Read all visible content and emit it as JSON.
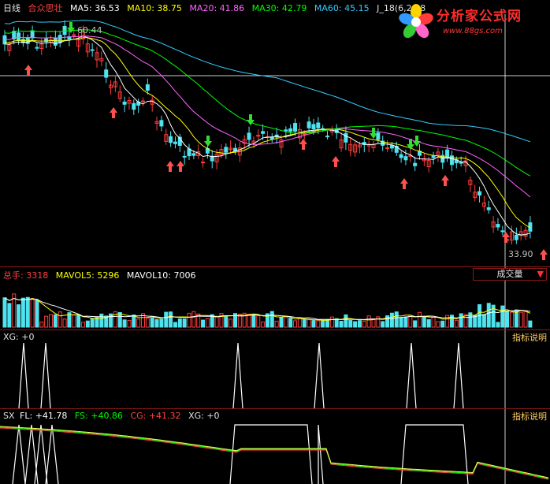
{
  "main": {
    "period": "日线",
    "stock": "合众思壮",
    "ma": [
      {
        "label": "MA5: 36.53",
        "color": "#ffffff"
      },
      {
        "label": "MA10: 38.75",
        "color": "#ffff00"
      },
      {
        "label": "MA20: 41.86",
        "color": "#ff66ff"
      },
      {
        "label": "MA30: 42.79",
        "color": "#00ff00"
      },
      {
        "label": "MA60: 45.15",
        "color": "#33ccff"
      }
    ],
    "extra": "J_18(6,20,8",
    "high_label": "60.44",
    "low_label": "33.90"
  },
  "logo": {
    "title": "分析家公式网",
    "url": "www.88gs.com"
  },
  "volume": {
    "name": "总手:",
    "value": "3318",
    "mavol5": "MAVOL5: 5296",
    "mavol10": "MAVOL10: 7006",
    "button": "成交量"
  },
  "xg_panel": {
    "label": "XG: +0",
    "explain": "指标说明"
  },
  "sx_panel": {
    "name": "SX",
    "fl": "FL: +41.78",
    "fs": "FS: +40.86",
    "cg": "CG: +41.32",
    "xg": "XG: +0",
    "explain": "指标说明"
  },
  "colors": {
    "up": "#ff3b3b",
    "down": "#4fe3f0",
    "panel_border": "#8b1a1a"
  }
}
